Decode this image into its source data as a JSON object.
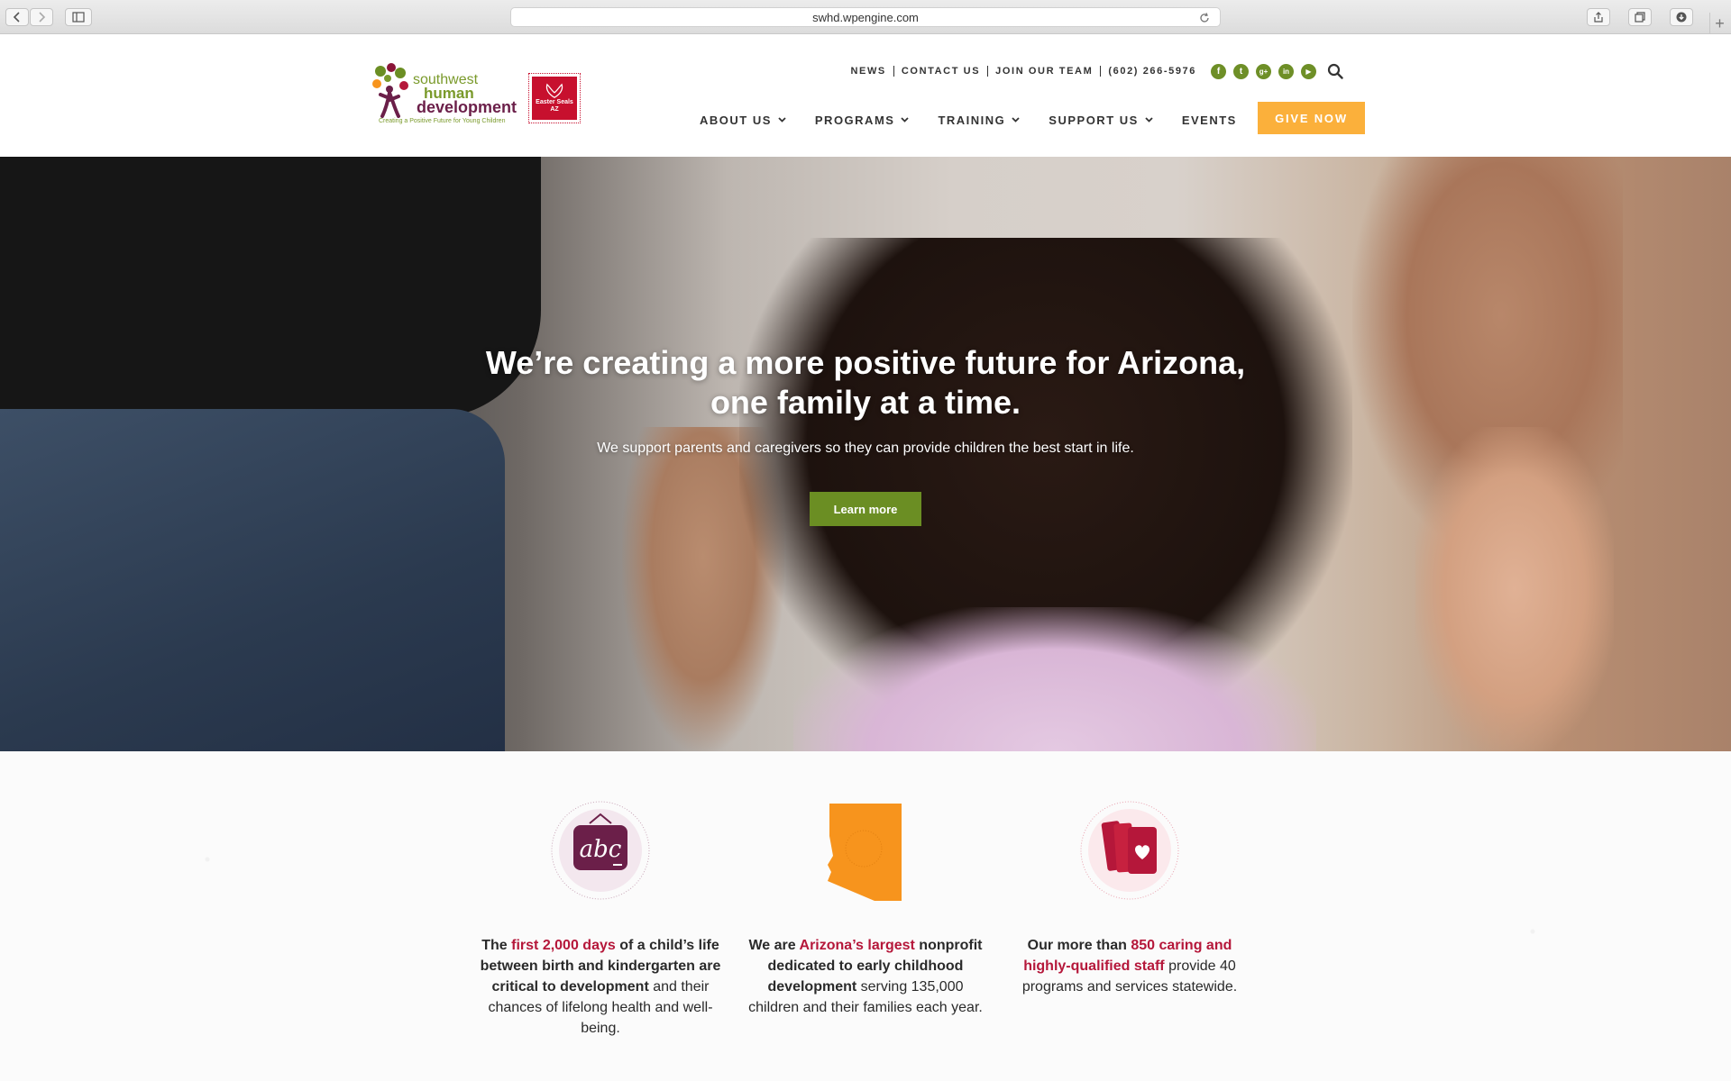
{
  "browser": {
    "url": "swhd.wpengine.com"
  },
  "header": {
    "logo_primary": {
      "word1": "southwest",
      "word2": "human",
      "word3": "development",
      "tagline": "Creating a Positive Future for Young Children"
    },
    "logo_secondary": {
      "line1": "Easter Seals",
      "line2": "AZ"
    },
    "utility_links": [
      "NEWS",
      "CONTACT US",
      "JOIN OUR TEAM",
      "(602) 266-5976"
    ],
    "social": [
      {
        "icon": "facebook-icon",
        "glyph": "f"
      },
      {
        "icon": "twitter-icon",
        "glyph": "t"
      },
      {
        "icon": "google-plus-icon",
        "glyph": "g+"
      },
      {
        "icon": "linkedin-icon",
        "glyph": "in"
      },
      {
        "icon": "youtube-icon",
        "glyph": "▶"
      }
    ],
    "nav": [
      {
        "label": "ABOUT US",
        "dropdown": true
      },
      {
        "label": "PROGRAMS",
        "dropdown": true
      },
      {
        "label": "TRAINING",
        "dropdown": true
      },
      {
        "label": "SUPPORT US",
        "dropdown": true
      },
      {
        "label": "EVENTS",
        "dropdown": false
      }
    ],
    "cta_label": "GIVE NOW"
  },
  "hero": {
    "title": "We’re creating a more positive future for Arizona, one family at a time.",
    "subtitle": "We support parents and caregivers so they can provide children the best start in life.",
    "button_label": "Learn more"
  },
  "stats": [
    {
      "icon": "abc-sign-icon",
      "icon_text": "abc",
      "parts": [
        {
          "t": "The ",
          "s": "bold"
        },
        {
          "t": "first 2,000 days",
          "s": "hl"
        },
        {
          "t": " of a child’s life between birth and kindergarten are critical to development",
          "s": "bold"
        },
        {
          "t": " and their chances of lifelong health and well-being.",
          "s": "plain"
        }
      ]
    },
    {
      "icon": "arizona-map-icon",
      "parts": [
        {
          "t": "We are ",
          "s": "bold"
        },
        {
          "t": "Arizona’s largest",
          "s": "hl"
        },
        {
          "t": " nonprofit dedicated to early childhood development",
          "s": "bold"
        },
        {
          "t": " serving 135,000 children and their families each year.",
          "s": "plain"
        }
      ]
    },
    {
      "icon": "books-heart-icon",
      "parts": [
        {
          "t": "Our more than ",
          "s": "bold"
        },
        {
          "t": "850 caring and highly-qualified staff",
          "s": "hl"
        },
        {
          "t": " provide 40 programs and services statewide.",
          "s": "plain"
        }
      ]
    }
  ],
  "colors": {
    "brand_green": "#6b8e23",
    "brand_plum": "#6b1f49",
    "accent_orange": "#fbb03b",
    "highlight_red": "#b5173a",
    "arizona_orange": "#f7941d"
  }
}
